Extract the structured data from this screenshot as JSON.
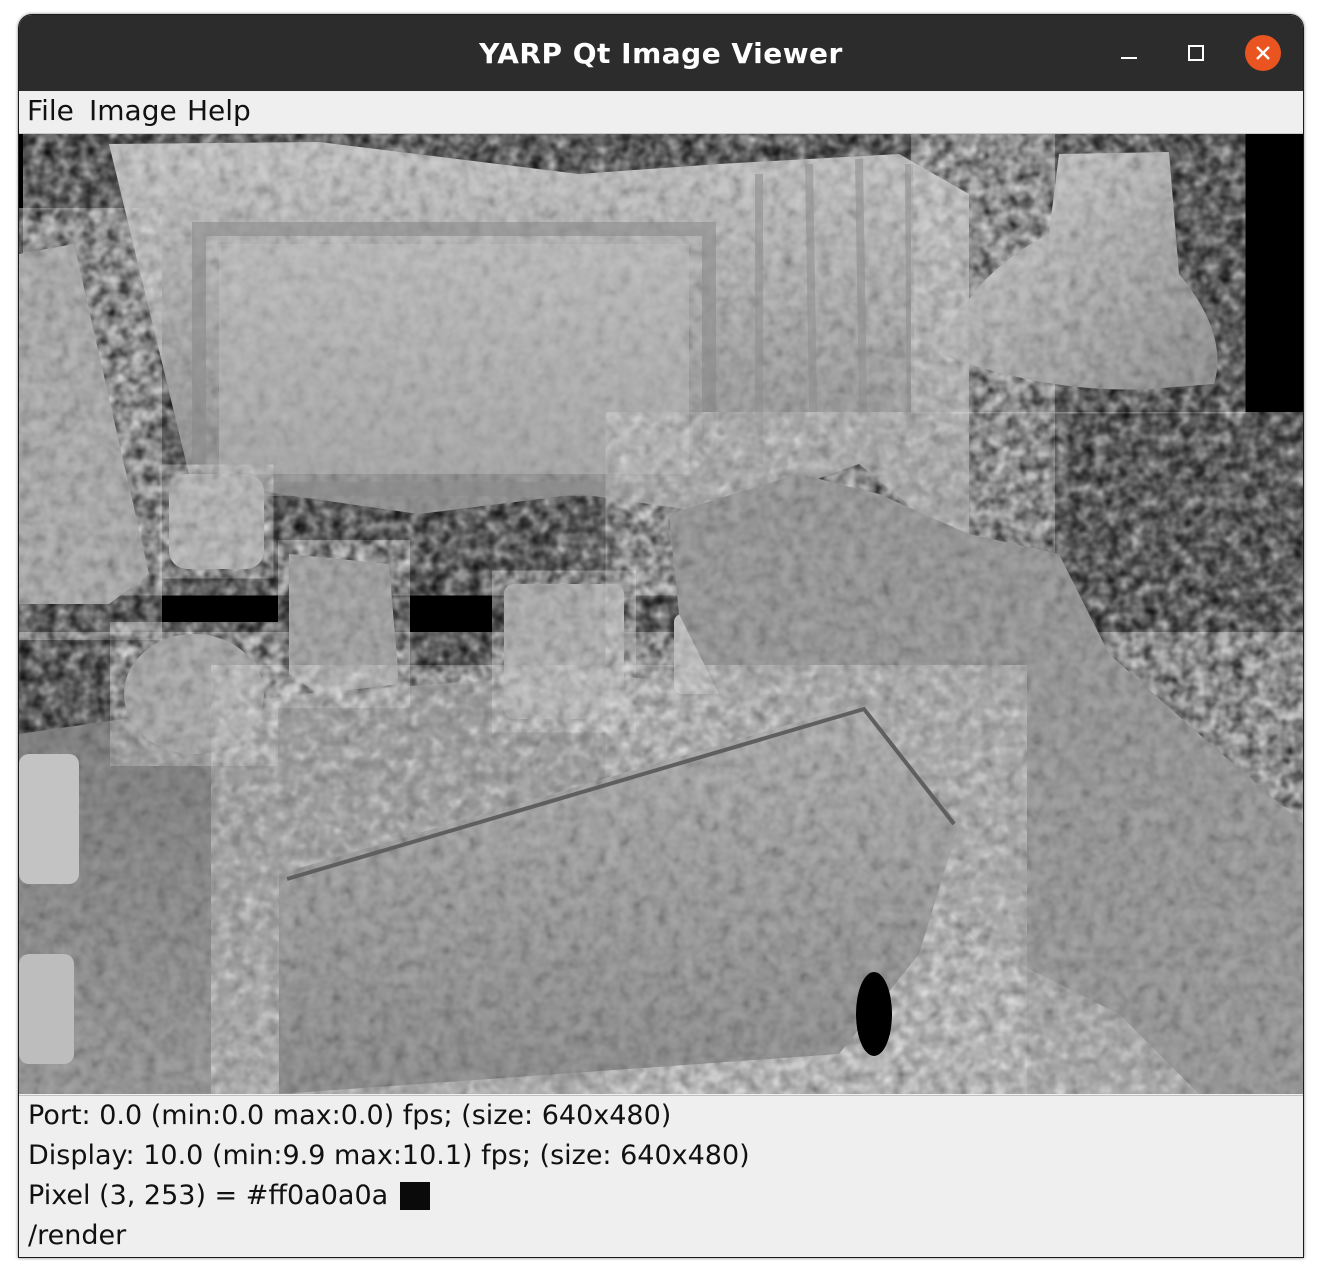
{
  "window": {
    "title": "YARP Qt Image Viewer"
  },
  "menu": {
    "items": [
      "File",
      "Image",
      "Help"
    ]
  },
  "image_view": {
    "content": "rendered grayscale 3D surface reconstruction of a desk scene"
  },
  "status": {
    "port": "Port: 0.0 (min:0.0 max:0.0) fps; (size: 640x480)",
    "display": "Display: 10.0 (min:9.9 max:10.1) fps; (size: 640x480)",
    "pixel": "Pixel (3, 253) = #ff0a0a0a",
    "pixel_color": "#0a0a0a",
    "port_name": "/render"
  },
  "colors": {
    "titlebar": "#2c2c2c",
    "close_button": "#e95420",
    "background": "#efefef",
    "viewport_bg": "#000000"
  }
}
